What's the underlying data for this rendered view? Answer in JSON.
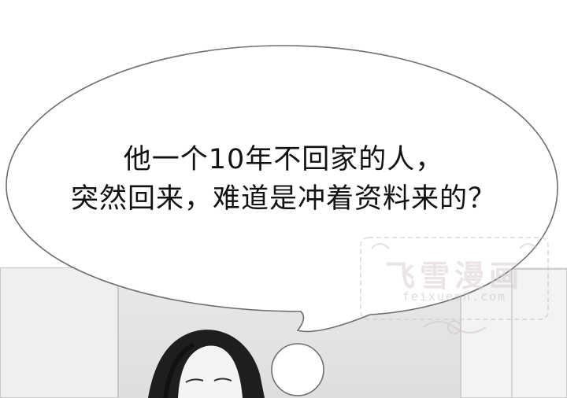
{
  "dialogue": {
    "line1": "他一个10年不回家的人，",
    "line2": "突然回来，难道是冲着资料来的？"
  },
  "watermark": {
    "title": "飞雪漫画",
    "url": "feixuemh.com"
  },
  "colors": {
    "bubble_fill": "#ffffff",
    "bubble_stroke": "#6f6f6f",
    "text": "#111111"
  }
}
